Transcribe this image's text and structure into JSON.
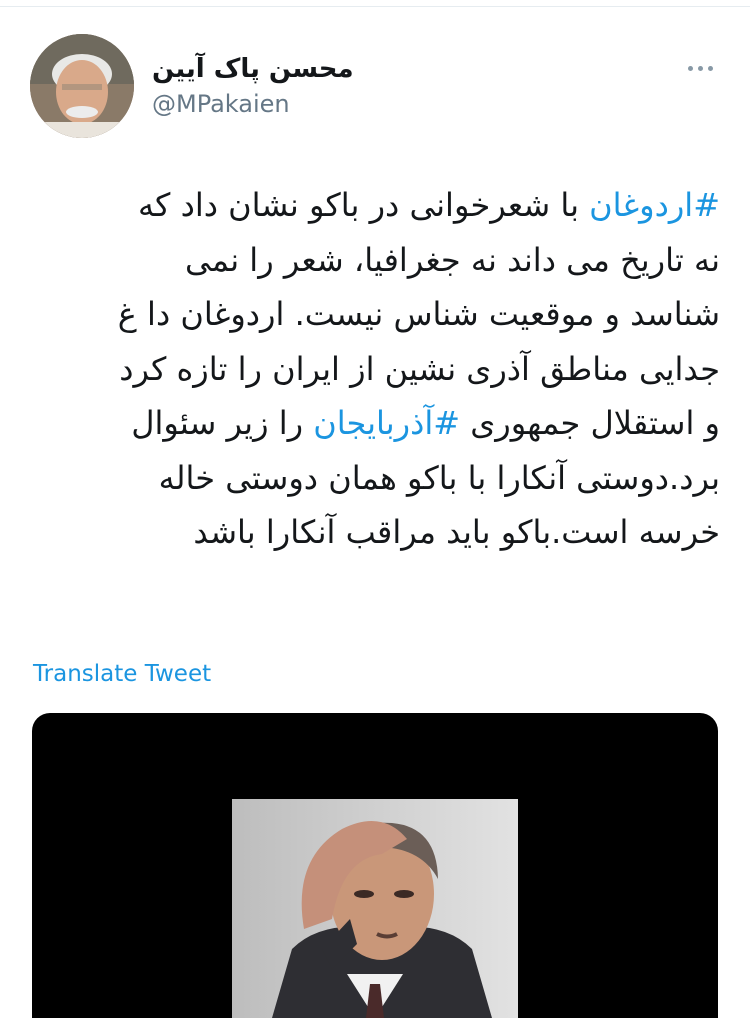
{
  "user": {
    "display_name": "محسن پاک آیین",
    "handle": "@MPakaien"
  },
  "tweet": {
    "lines": [
      [
        {
          "text": "#اردوغان",
          "hashtag": true
        },
        {
          "text": " با شعرخوانی در باکو نشان داد که",
          "hashtag": false
        }
      ],
      [
        {
          "text": "نه تاریخ می داند نه جغرافیا، شعر را نمی",
          "hashtag": false
        }
      ],
      [
        {
          "text": "شناسد و موقعیت شناس نیست. اردوغان دا غ",
          "hashtag": false
        }
      ],
      [
        {
          "text": "جدایی مناطق آذری نشین از ایران را تازه کرد",
          "hashtag": false
        }
      ],
      [
        {
          "text": "و استقلال جمهوری ",
          "hashtag": false
        },
        {
          "text": "#آذربایجان",
          "hashtag": true
        },
        {
          "text": " را زیر سئوال",
          "hashtag": false
        }
      ],
      [
        {
          "text": "برد.دوستی آنکارا با باکو همان دوستی خاله",
          "hashtag": false
        }
      ],
      [
        {
          "text": "خرسه است.باکو باید مراقب آنکارا باشد",
          "hashtag": false
        }
      ]
    ],
    "translate_label": "Translate Tweet"
  },
  "icons": {
    "more": "more-horizontal-icon"
  },
  "colors": {
    "link": "#1b95e0",
    "text": "#14171a",
    "muted": "#657786"
  }
}
